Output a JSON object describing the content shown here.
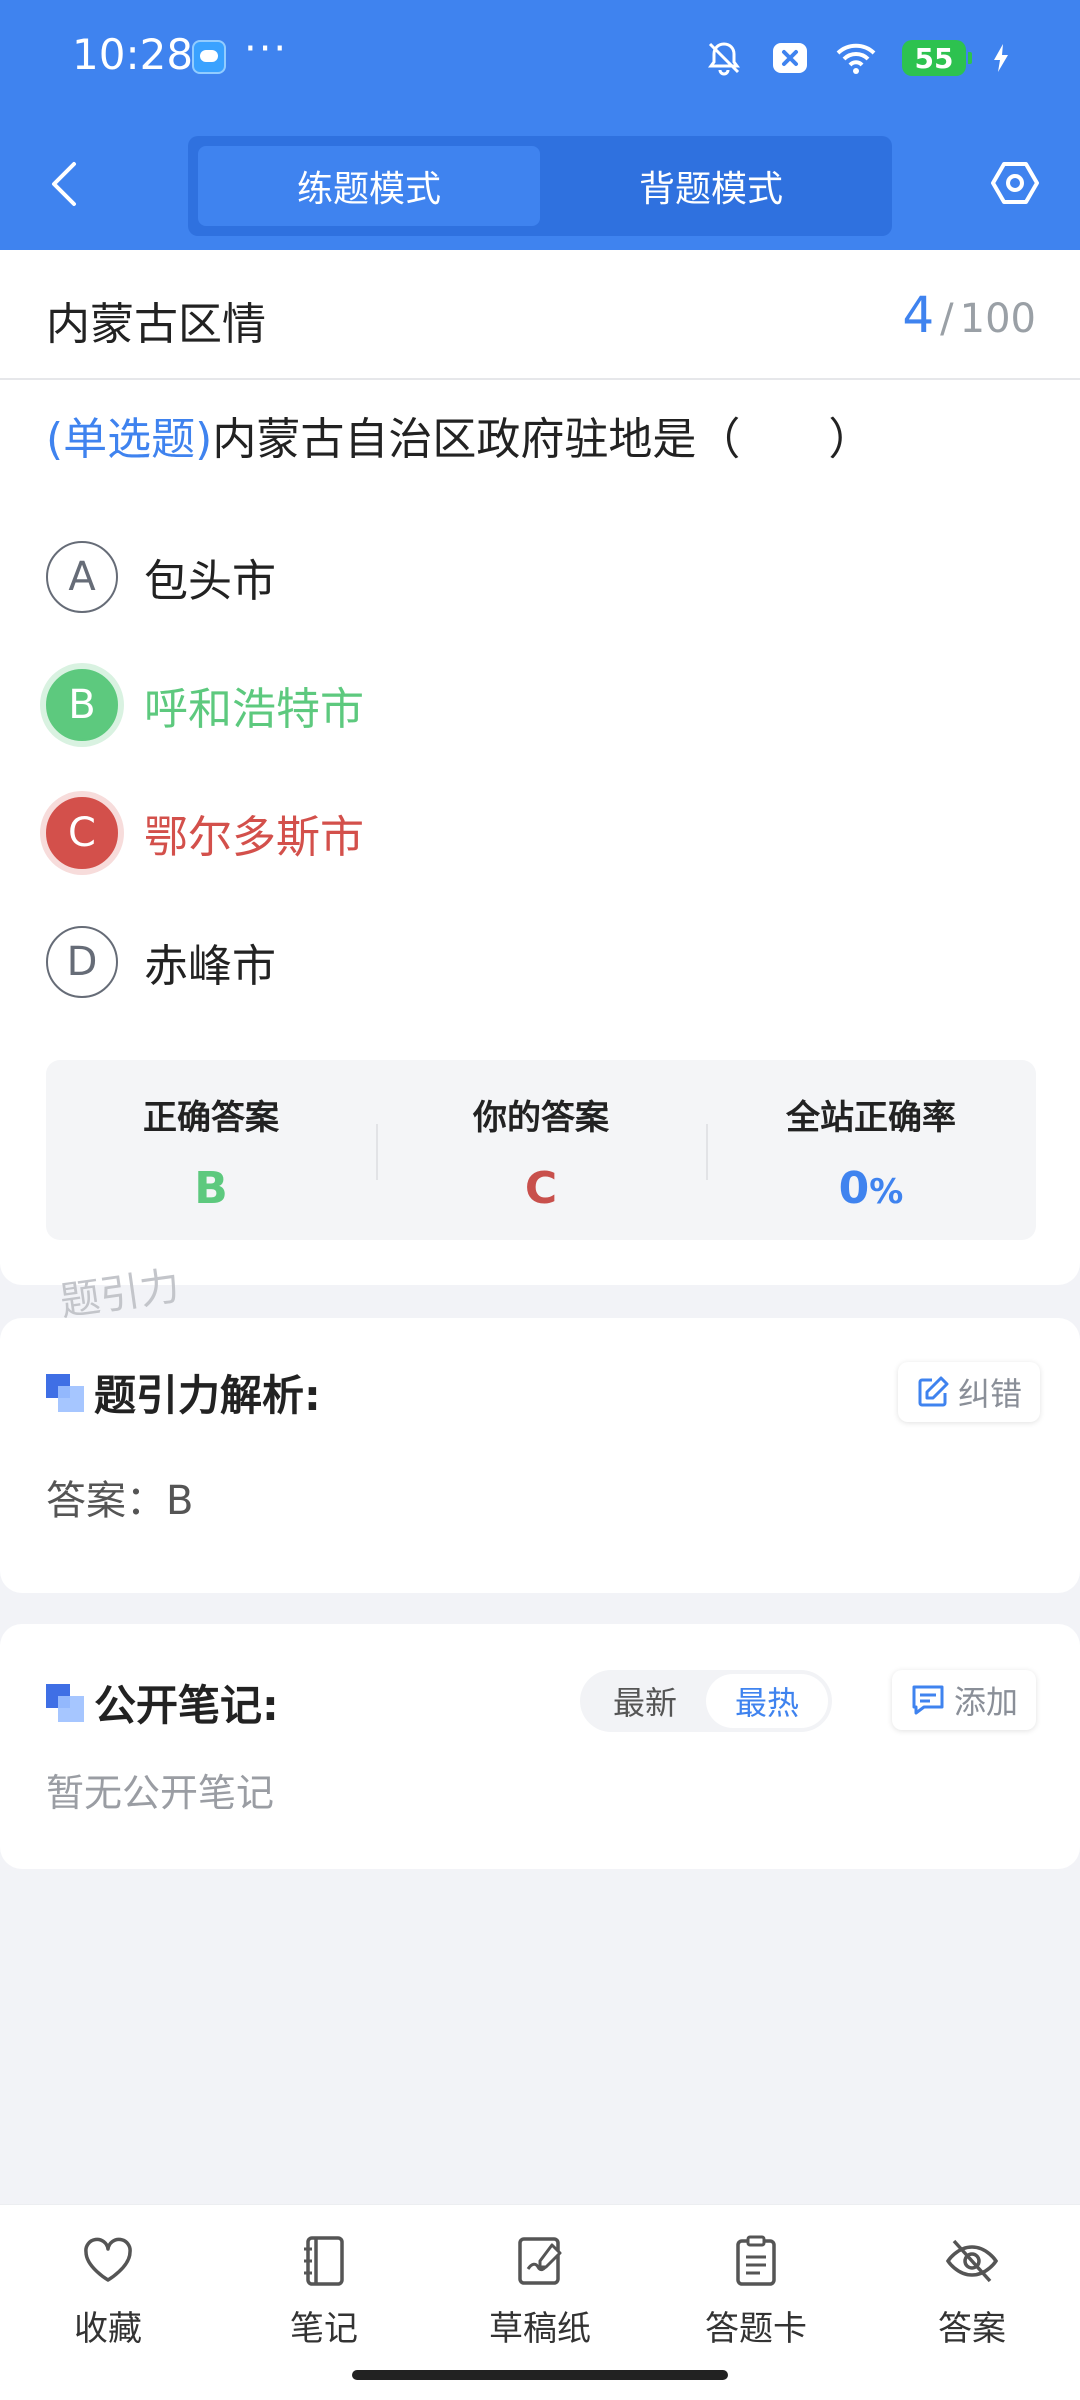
{
  "status_bar": {
    "time": "10:28",
    "dots": "···",
    "battery": "55"
  },
  "header": {
    "tabs": [
      {
        "label": "练题模式",
        "active": true
      },
      {
        "label": "背题模式",
        "active": false
      }
    ]
  },
  "subject": {
    "title": "内蒙古区情",
    "current": "4",
    "separator": "/",
    "total": "100"
  },
  "question": {
    "type": "(单选题)",
    "text": "内蒙古自治区政府驻地是（　　）",
    "options": [
      {
        "letter": "A",
        "text": "包头市",
        "state": "normal"
      },
      {
        "letter": "B",
        "text": "呼和浩特市",
        "state": "correct"
      },
      {
        "letter": "C",
        "text": "鄂尔多斯市",
        "state": "wrong"
      },
      {
        "letter": "D",
        "text": "赤峰市",
        "state": "normal"
      }
    ]
  },
  "stats": {
    "correct_label": "正确答案",
    "correct_value": "B",
    "yours_label": "你的答案",
    "yours_value": "C",
    "rate_label": "全站正确率",
    "rate_value": "0",
    "rate_unit": "%"
  },
  "watermark": "题引力",
  "analysis": {
    "title": "题引力解析:",
    "correct_btn": "纠错",
    "answer": "答案：B"
  },
  "notes": {
    "title": "公开笔记:",
    "sort_latest": "最新",
    "sort_hot": "最热",
    "add_btn": "添加",
    "empty": "暂无公开笔记"
  },
  "bottom_nav": [
    {
      "label": "收藏",
      "icon": "heart-icon"
    },
    {
      "label": "笔记",
      "icon": "notebook-icon"
    },
    {
      "label": "草稿纸",
      "icon": "draft-icon"
    },
    {
      "label": "答题卡",
      "icon": "answer-sheet-icon"
    },
    {
      "label": "答案",
      "icon": "eye-off-icon"
    }
  ],
  "colors": {
    "primary": "#3f83ef",
    "correct": "#5dc97e",
    "wrong": "#d3504b"
  }
}
